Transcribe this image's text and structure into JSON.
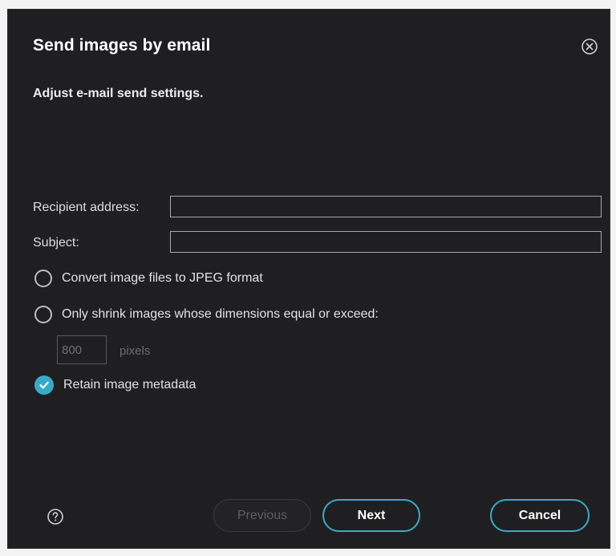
{
  "dialog": {
    "title": "Send images by email",
    "subtitle": "Adjust e-mail send settings."
  },
  "form": {
    "recipient_label": "Recipient address:",
    "recipient_value": "",
    "subject_label": "Subject:",
    "subject_value": "",
    "convert_jpeg_label": "Convert image files to JPEG format",
    "convert_jpeg_checked": false,
    "shrink_label": "Only shrink images whose dimensions equal or exceed:",
    "shrink_checked": false,
    "shrink_size_value": "800",
    "shrink_unit_label": "pixels",
    "retain_metadata_label": "Retain image metadata",
    "retain_metadata_checked": true
  },
  "footer": {
    "previous_label": "Previous",
    "next_label": "Next",
    "cancel_label": "Cancel"
  },
  "icons": {
    "close": "close-circle-icon",
    "help": "help-circle-icon",
    "check": "checkmark-icon"
  },
  "colors": {
    "background": "#1f1f21",
    "accent": "#3aa9c8",
    "text": "#e6e6e6",
    "disabled_text": "#5e5e5e"
  }
}
